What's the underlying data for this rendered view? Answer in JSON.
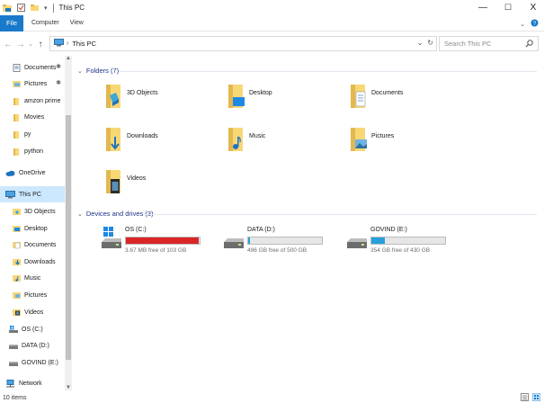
{
  "window": {
    "title": "This PC",
    "controls": {
      "minimize": "—",
      "maximize": "☐",
      "close": "X"
    }
  },
  "ribbon": {
    "tabs": [
      "File",
      "Computer",
      "View"
    ],
    "active_tab": "File"
  },
  "address": {
    "back_icon": "arrow-left",
    "forward_icon": "arrow-right",
    "history_icon": "chevron-down",
    "up_icon": "arrow-up",
    "path": "This PC",
    "search_placeholder": "Search This PC"
  },
  "nav": {
    "items": [
      {
        "label": "Documents",
        "icon": "documents-icon",
        "pinned": true
      },
      {
        "label": "Pictures",
        "icon": "pictures-icon",
        "pinned": true
      },
      {
        "label": "amzon prime",
        "icon": "folder-icon",
        "pinned": false
      },
      {
        "label": "Movies",
        "icon": "folder-icon",
        "pinned": false
      },
      {
        "label": "py",
        "icon": "folder-icon",
        "pinned": false
      },
      {
        "label": "python",
        "icon": "folder-icon",
        "pinned": false
      },
      {
        "label": "OneDrive",
        "icon": "onedrive-icon",
        "pinned": false
      },
      {
        "label": "This PC",
        "icon": "this-pc-icon",
        "pinned": false,
        "selected": true
      },
      {
        "label": "3D Objects",
        "icon": "3d-objects-icon",
        "pinned": false
      },
      {
        "label": "Desktop",
        "icon": "desktop-icon",
        "pinned": false
      },
      {
        "label": "Documents",
        "icon": "documents-icon",
        "pinned": false
      },
      {
        "label": "Downloads",
        "icon": "downloads-icon",
        "pinned": false
      },
      {
        "label": "Music",
        "icon": "music-icon",
        "pinned": false
      },
      {
        "label": "Pictures",
        "icon": "pictures-icon",
        "pinned": false
      },
      {
        "label": "Videos",
        "icon": "videos-icon",
        "pinned": false
      },
      {
        "label": "OS (C:)",
        "icon": "drive-c-icon",
        "pinned": false
      },
      {
        "label": "DATA (D:)",
        "icon": "drive-icon",
        "pinned": false
      },
      {
        "label": "GOVIND (E:)",
        "icon": "drive-icon",
        "pinned": false
      },
      {
        "label": "Network",
        "icon": "network-icon",
        "pinned": false
      }
    ]
  },
  "content": {
    "folders_header": "Folders (7)",
    "folders": [
      {
        "label": "3D Objects",
        "icon": "3d-objects-icon"
      },
      {
        "label": "Desktop",
        "icon": "desktop-icon"
      },
      {
        "label": "Documents",
        "icon": "documents-icon"
      },
      {
        "label": "Downloads",
        "icon": "downloads-icon"
      },
      {
        "label": "Music",
        "icon": "music-icon"
      },
      {
        "label": "Pictures",
        "icon": "pictures-icon"
      },
      {
        "label": "Videos",
        "icon": "videos-icon"
      }
    ],
    "drives_header": "Devices and drives (3)",
    "drives": [
      {
        "label": "OS (C:)",
        "free": "3.67 MB free of 103 GB",
        "used_fraction": 0.99,
        "bar_color": "#da2626",
        "icon": "windows-drive-icon"
      },
      {
        "label": "DATA (D:)",
        "free": "496 GB free of 500 GB",
        "used_fraction": 0.01,
        "bar_color": "#26a0da",
        "icon": "drive-icon"
      },
      {
        "label": "GOVIND (E:)",
        "free": "354 GB free of 430 GB",
        "used_fraction": 0.18,
        "bar_color": "#26a0da",
        "icon": "drive-icon"
      }
    ]
  },
  "status": {
    "items_count": "10 items"
  },
  "colors": {
    "accent": "#1979ca",
    "selection": "#cce8ff",
    "folder": "#f8d775",
    "header_text": "#1e3287",
    "drive_full": "#da2626",
    "drive_ok": "#26a0da"
  }
}
